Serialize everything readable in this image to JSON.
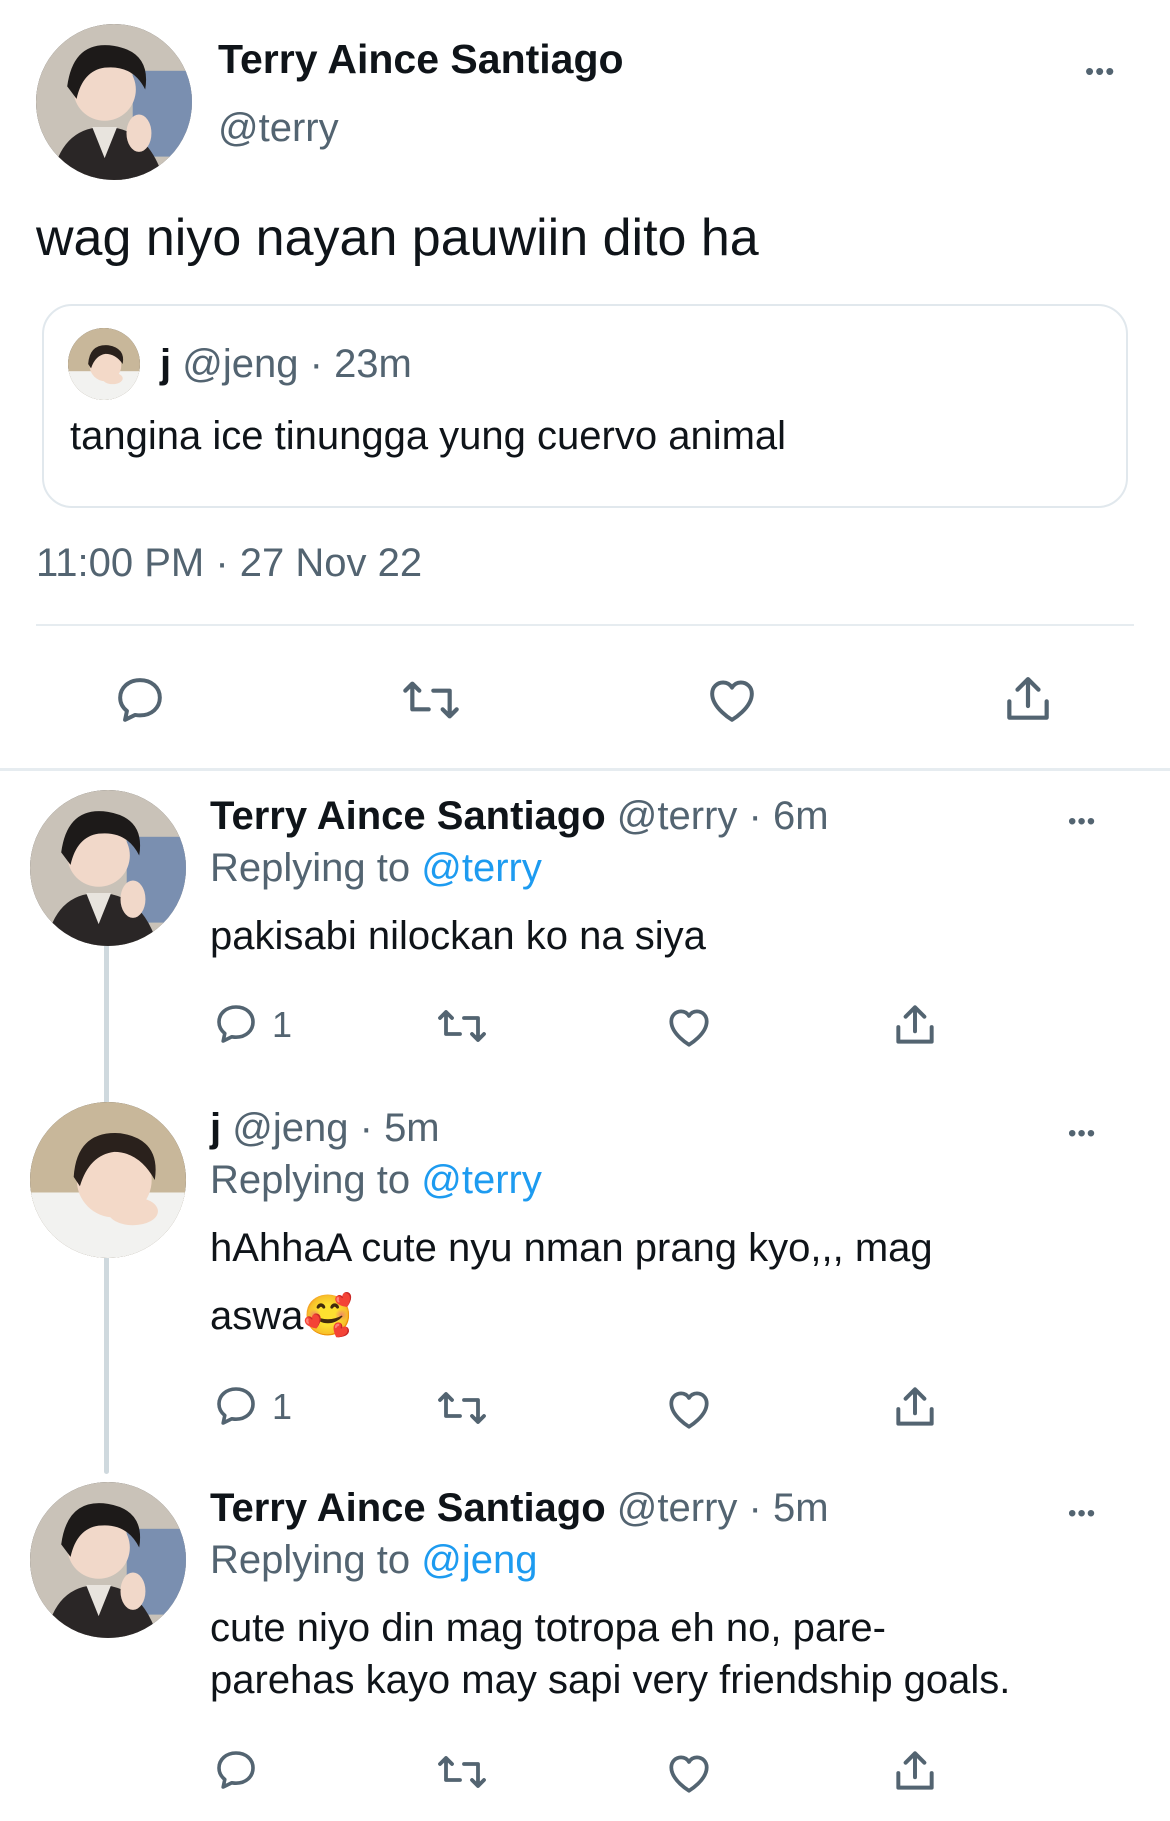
{
  "main_tweet": {
    "display_name": "Terry Aince Santiago",
    "handle": "@terry",
    "text": "wag niyo nayan pauwiin dito ha",
    "timestamp": "11:00 PM · 27 Nov 22",
    "more_label": "•••",
    "quoted": {
      "display_name": "j",
      "handle": "@jeng",
      "separator": "·",
      "time": "23m",
      "text": "tangina ice tinungga yung cuervo animal"
    }
  },
  "replies": [
    {
      "display_name": "Terry Aince Santiago",
      "handle": "@terry",
      "separator": "·",
      "time": "6m",
      "replying_to_label": "Replying to",
      "replying_to_handle": "@terry",
      "text": "pakisabi nilockan ko na siya",
      "reply_count": "1",
      "more_label": "•••"
    },
    {
      "display_name": "j",
      "handle": "@jeng",
      "separator": "·",
      "time": "5m",
      "replying_to_label": "Replying to",
      "replying_to_handle": "@terry",
      "text_line1": "hAhhaA cute nyu nman prang kyo,,, mag",
      "text_line2": "aswa🥰",
      "reply_count": "1",
      "more_label": "•••"
    },
    {
      "display_name": "Terry Aince Santiago",
      "handle": "@terry",
      "separator": "·",
      "time": "5m",
      "replying_to_label": "Replying to",
      "replying_to_handle": "@jeng",
      "text_line1": "cute niyo din mag totropa eh no, pare-",
      "text_line2": "parehas kayo may sapi very friendship goals.",
      "reply_count": "",
      "more_label": "•••"
    }
  ],
  "icons": {
    "reply": "reply-bubble-icon",
    "retweet": "retweet-arrows-icon",
    "like": "heart-icon",
    "share": "share-upload-icon",
    "more": "more-dots-icon"
  },
  "colors": {
    "text": "#0f1419",
    "muted": "#536471",
    "link": "#1d9bf0",
    "divider": "#e6ecf0"
  }
}
